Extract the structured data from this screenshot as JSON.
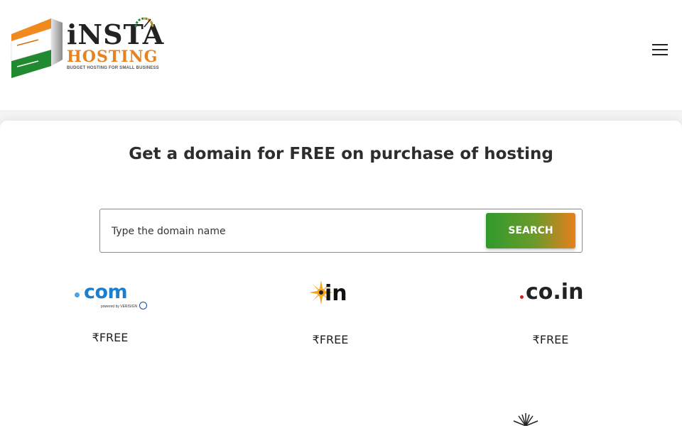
{
  "header": {
    "logo": {
      "word1": "iNSTA",
      "word2": "HOSTING",
      "tagline": "BUDGET HOSTING FOR SMALL BUSINESS"
    },
    "menu_icon": "hamburger-menu-icon"
  },
  "main": {
    "headline": "Get a domain for FREE on purchase of hosting",
    "search": {
      "placeholder": "Type the domain name",
      "button_label": "SEARCH"
    },
    "tlds": [
      {
        "name": ".com",
        "logo_text": "com",
        "sub": "powered by VERISIGN",
        "price": "₹FREE"
      },
      {
        "name": ".in",
        "logo_text": "in",
        "price": "₹FREE"
      },
      {
        "name": ".co.in",
        "logo_text": "co.in",
        "price": "₹FREE"
      }
    ]
  },
  "colors": {
    "brand_orange": "#e8821e",
    "brand_green": "#2f9a2c",
    "com_blue": "#1a7fd1"
  }
}
